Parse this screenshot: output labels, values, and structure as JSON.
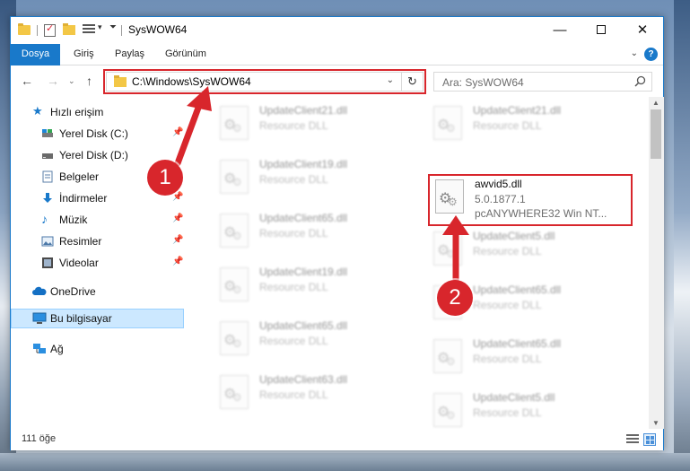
{
  "window": {
    "title": "SysWOW64",
    "controls": {
      "minimize": "—",
      "maximize": "",
      "close": "✕"
    }
  },
  "ribbon": {
    "tabs": [
      "Dosya",
      "Giriş",
      "Paylaş",
      "Görünüm"
    ],
    "help": "?"
  },
  "navigation": {
    "address": "C:\\Windows\\SysWOW64",
    "search_placeholder": "Ara: SysWOW64"
  },
  "sidebar": {
    "quick_access": "Hızlı erişim",
    "items": [
      {
        "label": "Yerel Disk (C:)",
        "icon": "drive-icon",
        "pinned": true
      },
      {
        "label": "Yerel Disk (D:)",
        "icon": "drive-icon",
        "pinned": false
      },
      {
        "label": "Belgeler",
        "icon": "documents-icon",
        "pinned": true
      },
      {
        "label": "İndirmeler",
        "icon": "download-icon",
        "pinned": true
      },
      {
        "label": "Müzik",
        "icon": "music-icon",
        "pinned": true
      },
      {
        "label": "Resimler",
        "icon": "pictures-icon",
        "pinned": true
      },
      {
        "label": "Videolar",
        "icon": "videos-icon",
        "pinned": true
      }
    ],
    "onedrive": "OneDrive",
    "this_pc": "Bu bilgisayar",
    "network": "Ağ"
  },
  "files": {
    "left_column": [
      {
        "name": "UpdateClient21.dll",
        "type": "Resource DLL"
      },
      {
        "name": "UpdateClient19.dll",
        "type": "Resource DLL"
      },
      {
        "name": "UpdateClient65.dll",
        "type": "Resource DLL"
      },
      {
        "name": "UpdateClient19.dll",
        "type": "Resource DLL"
      },
      {
        "name": "UpdateClient65.dll",
        "type": "Resource DLL"
      },
      {
        "name": "UpdateClient63.dll",
        "type": "Resource DLL"
      }
    ],
    "right_column": [
      {
        "name": "UpdateClient21.dll",
        "type": "Resource DLL"
      },
      {
        "name": "UpdateClient5.dll",
        "type": "Resource DLL"
      },
      {
        "name": "UpdateClient65.dll",
        "type": "Resource DLL"
      },
      {
        "name": "UpdateClient65.dll",
        "type": "Resource DLL"
      },
      {
        "name": "UpdateClient5.dll",
        "type": "Resource DLL"
      }
    ],
    "target": {
      "name": "awvid5.dll",
      "version": "5.0.1877.1",
      "description": "pcANYWHERE32 Win NT..."
    }
  },
  "status": {
    "count": "111 öğe"
  },
  "callouts": {
    "first": "1",
    "second": "2"
  },
  "colors": {
    "accent": "#1979ca",
    "highlight": "#d8262c",
    "selected": "#cce8ff"
  }
}
